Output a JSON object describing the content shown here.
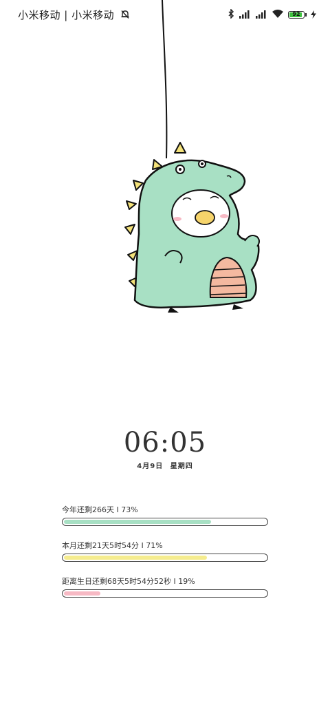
{
  "status_bar": {
    "carrier": "小米移动 | 小米移动",
    "battery_level": "92",
    "battery_fraction": 0.92,
    "battery_color": "#3fc23f",
    "icons": [
      "bell-muted-icon",
      "bluetooth-icon",
      "signal-icon",
      "signal-icon",
      "wifi-icon",
      "battery-icon",
      "charging-icon"
    ]
  },
  "lockscreen": {
    "time": "06:05",
    "date": "4月9日",
    "weekday": "星期四"
  },
  "progress": [
    {
      "label": "今年还剩266天 I 73%",
      "fraction": 0.73,
      "color": "#a8e0c4"
    },
    {
      "label": "本月还剩21天5时54分 I 71%",
      "fraction": 0.71,
      "color": "#f5ec8e"
    },
    {
      "label": "距离生日还剩68天5时54分52秒 I 19%",
      "fraction": 0.19,
      "color": "#f7b9c4"
    }
  ]
}
